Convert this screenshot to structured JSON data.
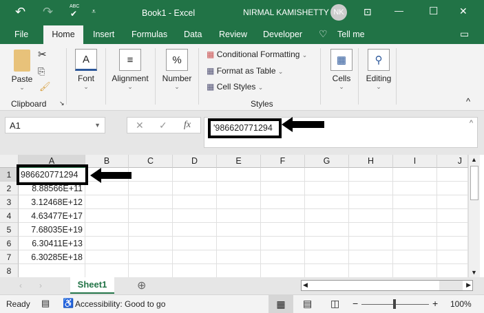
{
  "title_bar": {
    "undo": "↶",
    "redo": "↷",
    "spell": "ABC",
    "qat": "⩡",
    "doc_title": "Book1  -  Excel",
    "user": "NIRMAL KAMISHETTY",
    "initials": "NK",
    "restore": "⊡",
    "minimize": "—",
    "maximize": "☐",
    "close": "✕"
  },
  "tabs": [
    {
      "label": "File"
    },
    {
      "label": "Home"
    },
    {
      "label": "Insert"
    },
    {
      "label": "Formulas"
    },
    {
      "label": "Data"
    },
    {
      "label": "Review"
    },
    {
      "label": "Developer"
    }
  ],
  "tell_me": "Tell me",
  "ribbon": {
    "paste": "Paste",
    "clipboard": "Clipboard",
    "font": "Font",
    "alignment": "Alignment",
    "number": "Number",
    "conditional": "Conditional Formatting",
    "format_table": "Format as Table",
    "cell_styles": "Cell Styles",
    "styles": "Styles",
    "cells": "Cells",
    "editing": "Editing"
  },
  "name_box": "A1",
  "formula": "'986620771294",
  "columns": [
    "A",
    "B",
    "C",
    "D",
    "E",
    "F",
    "G",
    "H",
    "I",
    "J"
  ],
  "rows": [
    {
      "n": "1",
      "a": "986620771294"
    },
    {
      "n": "2",
      "a": "8.88566E+11"
    },
    {
      "n": "3",
      "a": "3.12468E+12"
    },
    {
      "n": "4",
      "a": "4.63477E+17"
    },
    {
      "n": "5",
      "a": "7.68035E+19"
    },
    {
      "n": "6",
      "a": "6.30411E+13"
    },
    {
      "n": "7",
      "a": "6.30285E+18"
    },
    {
      "n": "8",
      "a": ""
    }
  ],
  "sheet_tab": "Sheet1",
  "status": {
    "ready": "Ready",
    "accessibility": "Accessibility: Good to go",
    "zoom": "100%"
  },
  "colors": {
    "brand": "#217346"
  }
}
